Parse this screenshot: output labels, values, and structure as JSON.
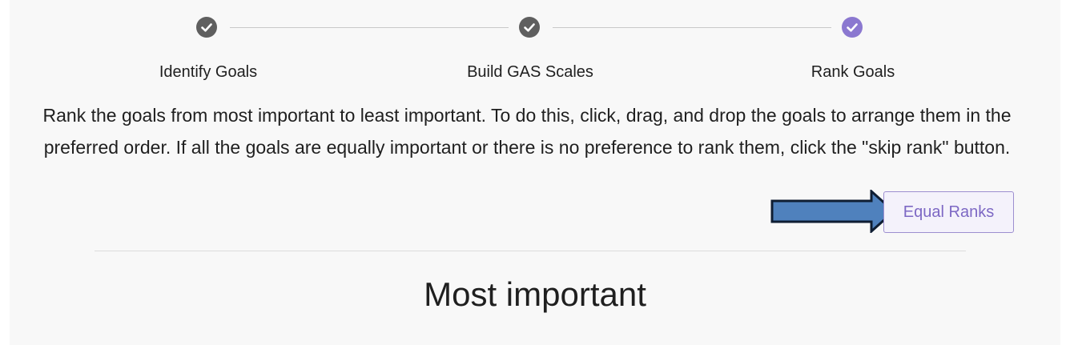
{
  "stepper": {
    "steps": [
      {
        "label": "Identify Goals",
        "status": "complete"
      },
      {
        "label": "Build GAS Scales",
        "status": "complete"
      },
      {
        "label": "Rank Goals",
        "status": "active"
      }
    ],
    "colors": {
      "complete": "#5f5f5f",
      "active": "#8b78d0"
    }
  },
  "instructions": {
    "text": "Rank the goals from most important to least important. To do this, click, drag, and drop the goals to arrange them in the preferred order. If all the goals are equally important or there is no preference to rank them, click the \"skip rank\" button."
  },
  "actions": {
    "equal_ranks_label": "Equal Ranks"
  },
  "annotation": {
    "icon": "arrow-right-icon",
    "color": "#4f81bd"
  },
  "ranking": {
    "section_title": "Most important"
  }
}
